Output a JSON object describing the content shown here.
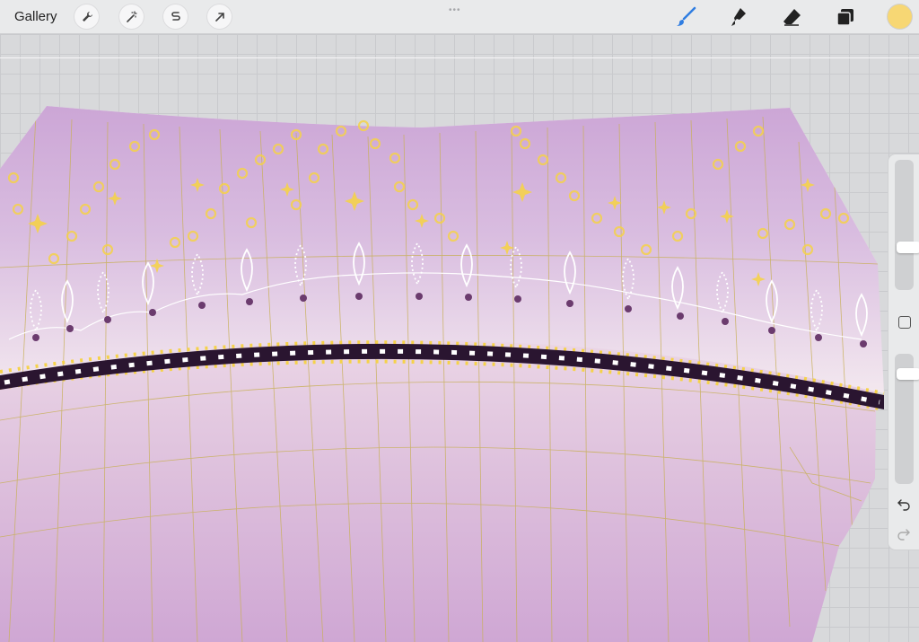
{
  "topbar": {
    "gallery_label": "Gallery",
    "left_tools": [
      "wrench-icon",
      "magic-wand-icon",
      "selection-s-icon",
      "arrow-icon"
    ],
    "right_tools": [
      "brush-icon",
      "smudge-icon",
      "eraser-icon",
      "layers-icon"
    ],
    "current_color": "#f7d774",
    "accent_color": "#2f7de1"
  },
  "canvas": {
    "palette": {
      "lilac": "#cca6d6",
      "pale": "#f3e8ef",
      "band": "#2a1530",
      "gold": "#f5d24a",
      "plum": "#6b3b6e",
      "white": "#ffffff"
    }
  },
  "sidebar": {
    "brush_size_level": 0.28,
    "opacity_level": 0.12
  }
}
